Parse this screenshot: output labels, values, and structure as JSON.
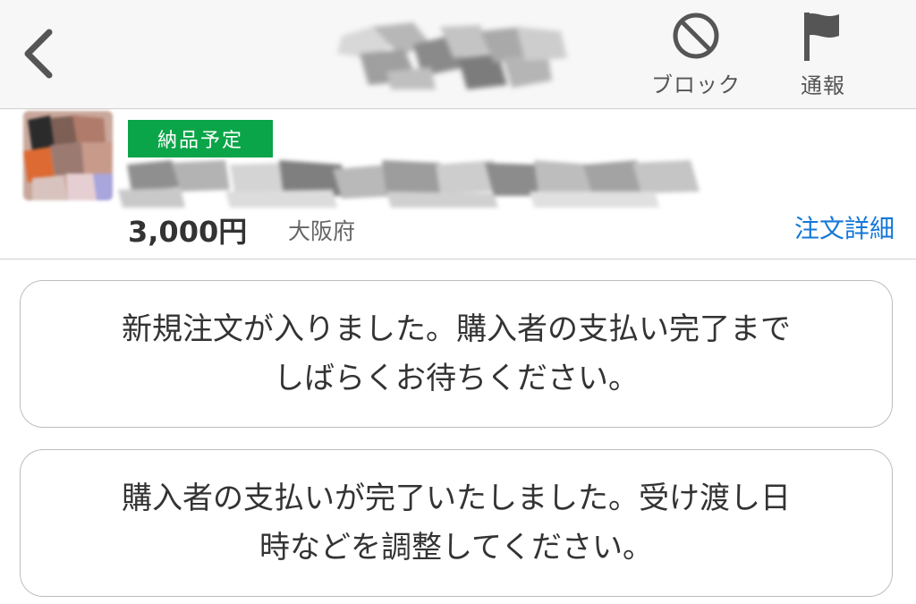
{
  "header": {
    "back_icon": "chevron-left-icon",
    "block": {
      "label": "ブロック",
      "icon": "prohibited-icon"
    },
    "report": {
      "label": "通報",
      "icon": "flag-icon"
    }
  },
  "order": {
    "status_badge": "納品予定",
    "badge_color": "#0aa548",
    "price": "3,000円",
    "prefecture": "大阪府",
    "detail_link": "注文詳細",
    "link_color": "#1578d8"
  },
  "messages": [
    {
      "line1": "新規注文が入りました。購入者の支払い完了まで",
      "line2": "しばらくお待ちください。"
    },
    {
      "line1": "購入者の支払いが完了いたしました。受け渡し日",
      "line2": "時などを調整してください。"
    }
  ]
}
